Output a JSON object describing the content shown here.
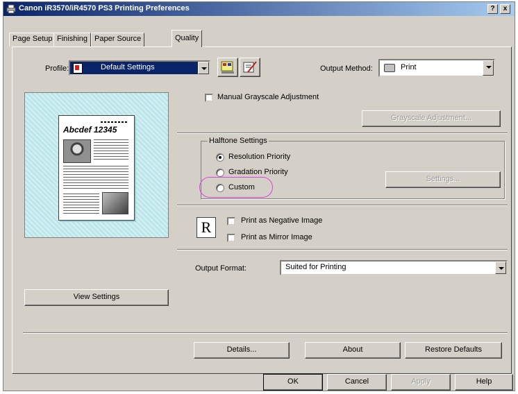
{
  "window": {
    "title": "Canon iR3570/iR4570 PS3 Printing Preferences",
    "help_btn": "?",
    "close_btn": "x"
  },
  "tabs": [
    {
      "label": "Page Setup"
    },
    {
      "label": "Finishing"
    },
    {
      "label": "Paper Source"
    },
    {
      "label": "Quality"
    }
  ],
  "profile": {
    "label": "Profile:",
    "value": "Default Settings"
  },
  "output_method": {
    "label": "Output Method:",
    "value": "Print"
  },
  "grayscale": {
    "manual_label": "Manual Grayscale Adjustment",
    "button": "Grayscale Adjustment..."
  },
  "halftone": {
    "title": "Halftone Settings",
    "options": [
      "Resolution Priority",
      "Gradation Priority",
      "Custom"
    ],
    "selected": "Resolution Priority",
    "settings_button": "Settings..."
  },
  "preview": {
    "heading": "Abcdef 12345",
    "view_settings": "View Settings"
  },
  "image_options": {
    "r_glyph": "R",
    "negative": "Print as Negative Image",
    "mirror": "Print as Mirror Image"
  },
  "output_format": {
    "label": "Output Format:",
    "value": "Suited for Printing"
  },
  "panel_buttons": {
    "details": "Details...",
    "about": "About",
    "restore": "Restore Defaults"
  },
  "dialog_buttons": {
    "ok": "OK",
    "cancel": "Cancel",
    "apply": "Apply",
    "help": "Help"
  },
  "colors": {
    "title_start": "#0a246a",
    "title_end": "#a6caf0",
    "highlight": "#e040e0",
    "dialog": "#d4d0c8"
  },
  "icons": {
    "profile": "profile-icon",
    "printer": "printer-icon",
    "edit_profile": "edit-profile-icon",
    "add_profile": "add-profile-icon"
  }
}
